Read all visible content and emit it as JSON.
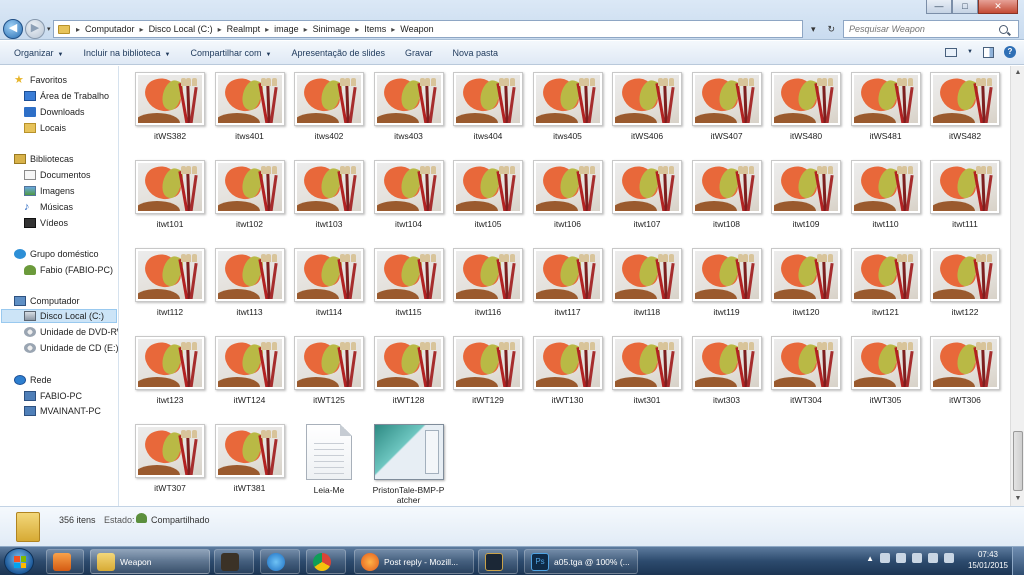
{
  "window": {
    "minimize_glyph": "—",
    "maximize_glyph": "□",
    "close_glyph": "✕"
  },
  "nav": {
    "back_glyph": "◀",
    "forward_glyph": "▶",
    "recent_glyph": "▾"
  },
  "address": {
    "breadcrumbs": [
      "Computador",
      "Disco Local (C:)",
      "Realmpt",
      "image",
      "Sinimage",
      "Items",
      "Weapon"
    ],
    "separator": "▸",
    "history_glyph": "▾",
    "refresh_glyph": "↻"
  },
  "search": {
    "placeholder": "Pesquisar Weapon"
  },
  "toolbar": {
    "organize": "Organizar",
    "include_library": "Incluir na biblioteca",
    "share": "Compartilhar com",
    "slideshow": "Apresentação de slides",
    "burn": "Gravar",
    "new_folder": "Nova pasta",
    "dropdown_glyph": "▼",
    "help_glyph": "?"
  },
  "sidebar": {
    "favorites": {
      "label": "Favoritos",
      "icon": "star-icon"
    },
    "favorites_items": [
      {
        "label": "Área de Trabalho",
        "icon": "desktop-icon"
      },
      {
        "label": "Downloads",
        "icon": "downloads-icon"
      },
      {
        "label": "Locais",
        "icon": "recent-places-icon"
      }
    ],
    "libraries": {
      "label": "Bibliotecas",
      "icon": "library-icon"
    },
    "libraries_items": [
      {
        "label": "Documentos",
        "icon": "documents-icon"
      },
      {
        "label": "Imagens",
        "icon": "pictures-icon"
      },
      {
        "label": "Músicas",
        "icon": "music-icon"
      },
      {
        "label": "Vídeos",
        "icon": "videos-icon"
      }
    ],
    "homegroup": {
      "label": "Grupo doméstico",
      "icon": "homegroup-icon"
    },
    "homegroup_items": [
      {
        "label": "Fabio (FABIO-PC)",
        "icon": "user-icon"
      }
    ],
    "computer": {
      "label": "Computador",
      "icon": "computer-icon"
    },
    "computer_items": [
      {
        "label": "Disco Local (C:)",
        "icon": "hard-disk-icon"
      },
      {
        "label": "Unidade de DVD-RW",
        "icon": "dvd-drive-icon"
      },
      {
        "label": "Unidade de CD (E:)",
        "icon": "cd-drive-icon"
      }
    ],
    "network": {
      "label": "Rede",
      "icon": "network-icon"
    },
    "network_items": [
      {
        "label": "FABIO-PC",
        "icon": "network-pc-icon"
      },
      {
        "label": "MVAINANT-PC",
        "icon": "network-pc-icon"
      }
    ]
  },
  "files": [
    "itWS382",
    "itws401",
    "itws402",
    "itws403",
    "itws404",
    "itws405",
    "itWS406",
    "itWS407",
    "itWS480",
    "itWS481",
    "itWS482",
    "itwt101",
    "itwt102",
    "itwt103",
    "itwt104",
    "itwt105",
    "itwt106",
    "itwt107",
    "itwt108",
    "itwt109",
    "itwt110",
    "itwt111",
    "itwt112",
    "itwt113",
    "itwt114",
    "itwt115",
    "itwt116",
    "itwt117",
    "itwt118",
    "itwt119",
    "itwt120",
    "itwt121",
    "itwt122",
    "itwt123",
    "itWT124",
    "itWT125",
    "itWT128",
    "itWT129",
    "itWT130",
    "itwt301",
    "itwt303",
    "itWT304",
    "itWT305",
    "itWT306",
    "itWT307",
    "itWT381",
    "Leia-Me",
    "PristonTale-BMP-Patcher"
  ],
  "details": {
    "count": "356 itens",
    "state_label": "Estado:",
    "state_value": "Compartilhado"
  },
  "taskbar": {
    "explorer_label": "Weapon",
    "firefox_label": "Post reply - Mozill...",
    "photoshop_label": "a05.tga @ 100% (...",
    "time": "07:43",
    "date": "15/01/2015",
    "tray_arrow": "▲"
  },
  "colors": {
    "accent": "#2f6fb5",
    "selection": "#cce4f7",
    "taskbar": "#2d4b6e"
  }
}
